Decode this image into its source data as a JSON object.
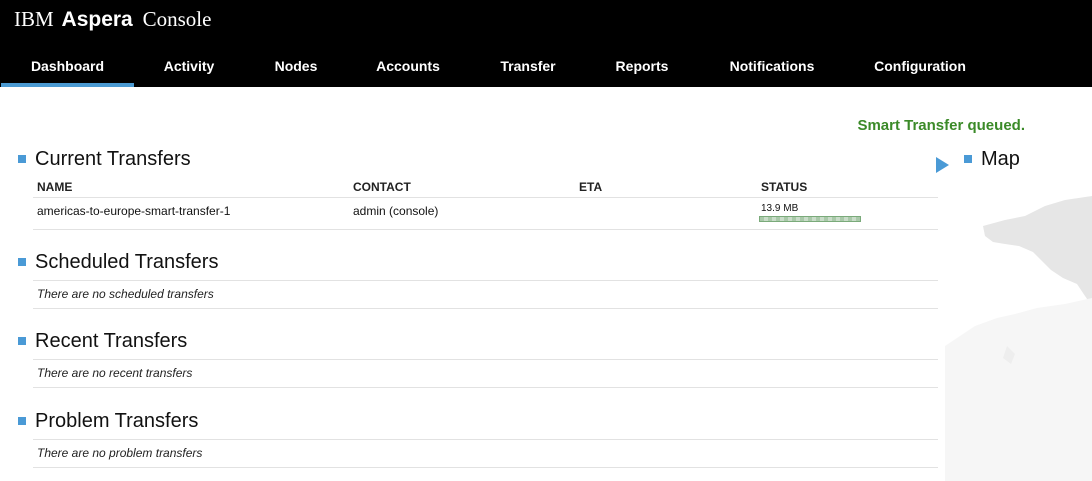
{
  "header": {
    "brand": {
      "part1": "IBM",
      "part2": "Aspera",
      "part3": "Console"
    },
    "nav": [
      {
        "label": "Dashboard",
        "active": true
      },
      {
        "label": "Activity"
      },
      {
        "label": "Nodes"
      },
      {
        "label": "Accounts"
      },
      {
        "label": "Transfer"
      },
      {
        "label": "Reports"
      },
      {
        "label": "Notifications"
      },
      {
        "label": "Configuration"
      }
    ]
  },
  "status_message": "Smart Transfer queued.",
  "current_transfers": {
    "title": "Current Transfers",
    "columns": [
      "NAME",
      "CONTACT",
      "ETA",
      "STATUS"
    ],
    "rows": [
      {
        "name": "americas-to-europe-smart-transfer-1",
        "contact": "admin (console)",
        "eta": "",
        "status": "13.9 MB",
        "progress": 1.0
      }
    ]
  },
  "scheduled_transfers": {
    "title": "Scheduled Transfers",
    "empty": "There are no scheduled transfers"
  },
  "recent_transfers": {
    "title": "Recent Transfers",
    "empty": "There are no recent transfers"
  },
  "problem_transfers": {
    "title": "Problem Transfers",
    "empty": "There are no problem transfers"
  },
  "map": {
    "title": "Map"
  },
  "colors": {
    "accent": "#4a9ad6",
    "success": "#3b8a28",
    "topbar": "#000000"
  }
}
